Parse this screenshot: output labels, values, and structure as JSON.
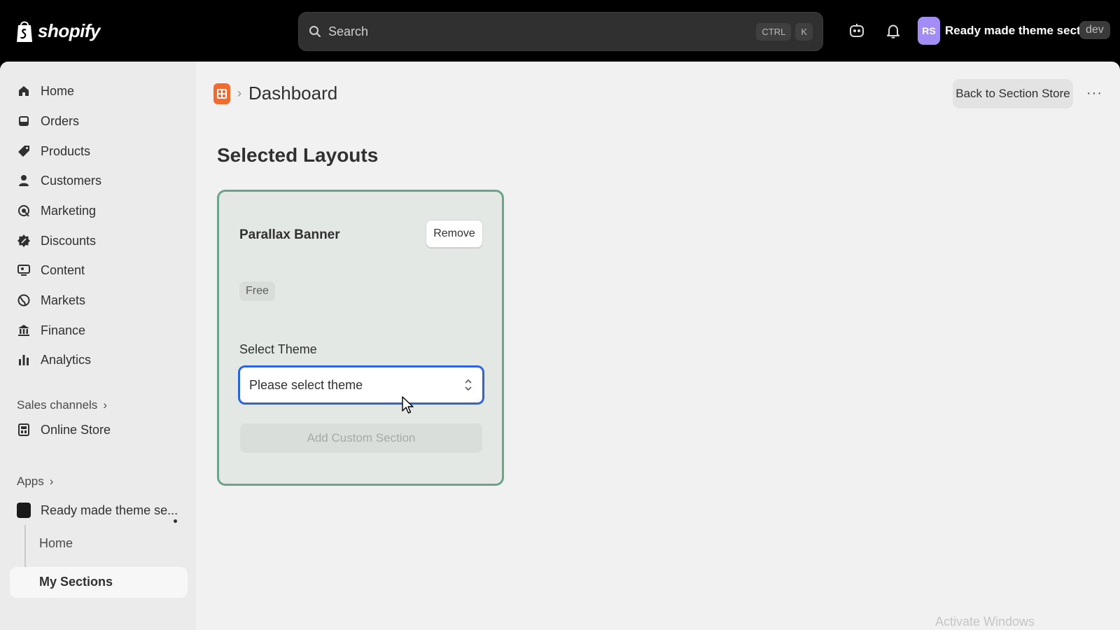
{
  "brand": {
    "logo_text": "shopify"
  },
  "search": {
    "placeholder": "Search",
    "shortcut_1": "CTRL",
    "shortcut_2": "K"
  },
  "topbar": {
    "avatar_initials": "RS",
    "store_name": "Ready made theme secti...",
    "env_badge": "dev"
  },
  "sidebar": {
    "items": [
      {
        "label": "Home",
        "icon": "home-icon"
      },
      {
        "label": "Orders",
        "icon": "orders-icon"
      },
      {
        "label": "Products",
        "icon": "tag-icon"
      },
      {
        "label": "Customers",
        "icon": "person-icon"
      },
      {
        "label": "Marketing",
        "icon": "target-icon"
      },
      {
        "label": "Discounts",
        "icon": "discount-icon"
      },
      {
        "label": "Content",
        "icon": "content-icon"
      },
      {
        "label": "Markets",
        "icon": "globe-icon"
      },
      {
        "label": "Finance",
        "icon": "bank-icon"
      },
      {
        "label": "Analytics",
        "icon": "bar-chart-icon"
      }
    ],
    "sales_channels_label": "Sales channels",
    "online_store_label": "Online Store",
    "apps_label": "Apps",
    "app_name": "Ready made theme se...",
    "app_sub_items": [
      "Home",
      "My Sections"
    ]
  },
  "header": {
    "page_title": "Dashboard",
    "back_button": "Back to Section Store",
    "more": "···"
  },
  "main": {
    "section_title": "Selected Layouts",
    "card": {
      "title": "Parallax Banner",
      "remove_label": "Remove",
      "badge": "Free",
      "select_label": "Select Theme",
      "select_value": "Please select theme",
      "add_button": "Add Custom Section"
    }
  },
  "watermark": "Activate Windows",
  "colors": {
    "accent_focus": "#2b64e3",
    "card_border": "#6aa58a",
    "app_icon": "#f26a2e",
    "avatar": "#a38cf5"
  }
}
